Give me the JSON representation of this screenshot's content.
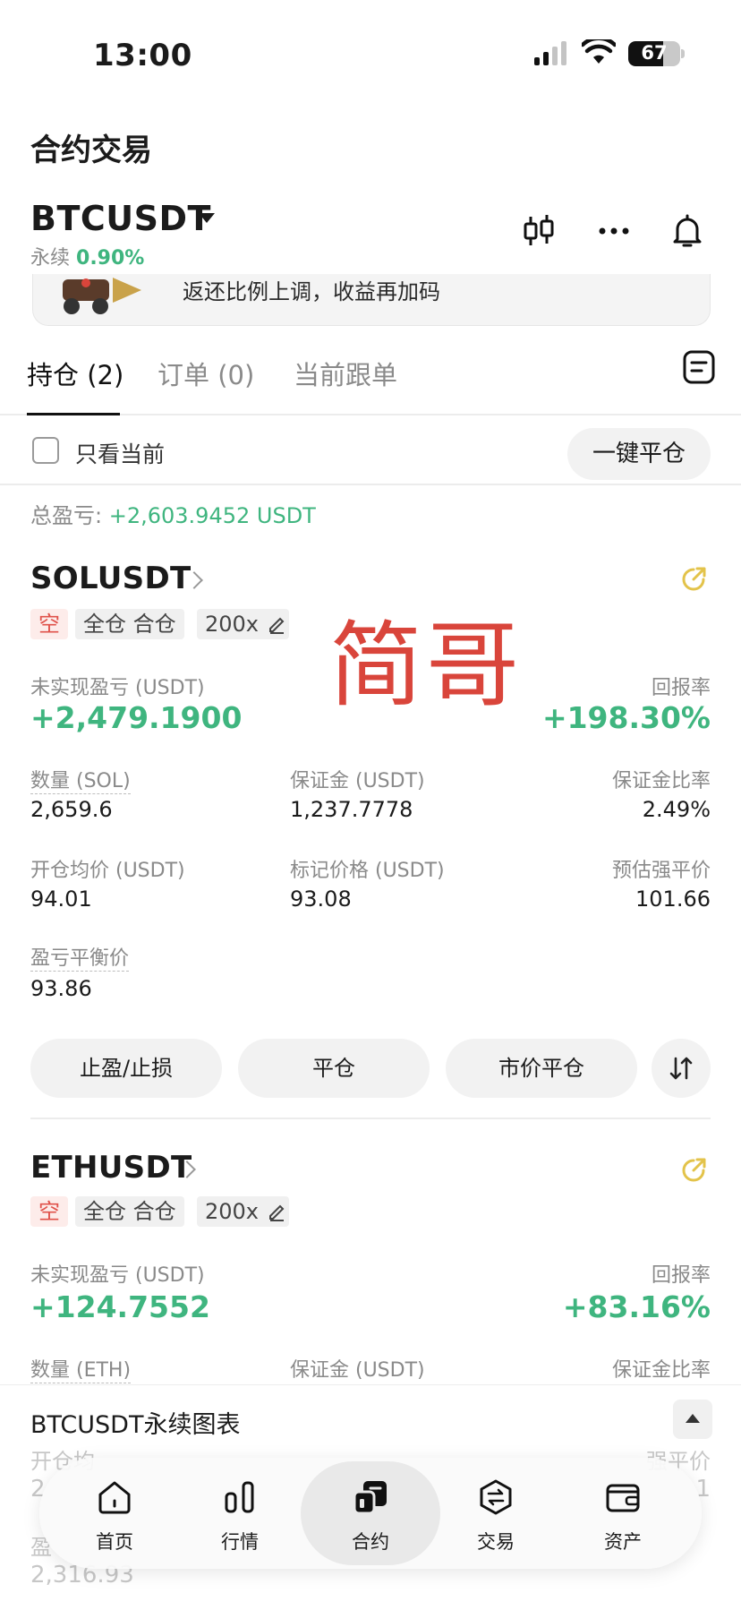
{
  "status_bar": {
    "time": "13:00",
    "battery": "67",
    "battery_level": 0.67
  },
  "header": {
    "title": "合约交易",
    "symbol": "BTCUSDT",
    "perpetual_label": "永续",
    "change": "0.90%",
    "icons": [
      "candlestick-icon",
      "more-icon",
      "bell-icon"
    ]
  },
  "banner": {
    "text": "返还比例上调，收益再加码"
  },
  "tabs": [
    {
      "label": "持仓 (2)",
      "active": true
    },
    {
      "label": "订单 (0)",
      "active": false
    },
    {
      "label": "当前跟单",
      "active": false
    }
  ],
  "filter": {
    "only_current": "只看当前",
    "close_all": "一键平仓"
  },
  "total_pnl": {
    "label": "总盈亏:",
    "value": "+2,603.9452 USDT"
  },
  "watermark": "简哥",
  "positions": [
    {
      "symbol": "SOLUSDT",
      "side": "空",
      "margin_mode": "全仓 合仓",
      "leverage": "200x",
      "unrealized_label": "未实现盈亏 (USDT)",
      "unrealized": "+2,479.1900",
      "roe_label": "回报率",
      "roe": "+198.30%",
      "qty_label": "数量 (SOL)",
      "qty": "2,659.6",
      "margin_label": "保证金 (USDT)",
      "margin": "1,237.7778",
      "margin_ratio_label": "保证金比率",
      "margin_ratio": "2.49%",
      "entry_label": "开仓均价 (USDT)",
      "entry": "94.01",
      "mark_label": "标记价格 (USDT)",
      "mark": "93.08",
      "liq_label": "预估强平价",
      "liq": "101.66",
      "breakeven_label": "盈亏平衡价",
      "breakeven": "93.86",
      "actions": [
        "止盈/止损",
        "平仓",
        "市价平仓"
      ]
    },
    {
      "symbol": "ETHUSDT",
      "side": "空",
      "margin_mode": "全仓 合仓",
      "leverage": "200x",
      "unrealized_label": "未实现盈亏 (USDT)",
      "unrealized": "+124.7552",
      "roe_label": "回报率",
      "roe": "+83.16%",
      "qty_label": "数量 (ETH)",
      "margin_label": "保证金 (USDT)",
      "margin_ratio_label": "保证金比率",
      "peek_left": "开仓均",
      "peek_left_val": "2",
      "peek_right": "强平价",
      "peek_right_val": "1",
      "peek_bottom_label": "盈",
      "peek_bottom_val": "2,316.93"
    }
  ],
  "chart_panel": {
    "title": "BTCUSDT永续图表"
  },
  "bottom_nav": [
    {
      "label": "首页",
      "icon": "home-icon",
      "active": false
    },
    {
      "label": "行情",
      "icon": "market-icon",
      "active": false
    },
    {
      "label": "合约",
      "icon": "futures-icon",
      "active": true
    },
    {
      "label": "交易",
      "icon": "trade-icon",
      "active": false
    },
    {
      "label": "资产",
      "icon": "wallet-icon",
      "active": false
    }
  ]
}
